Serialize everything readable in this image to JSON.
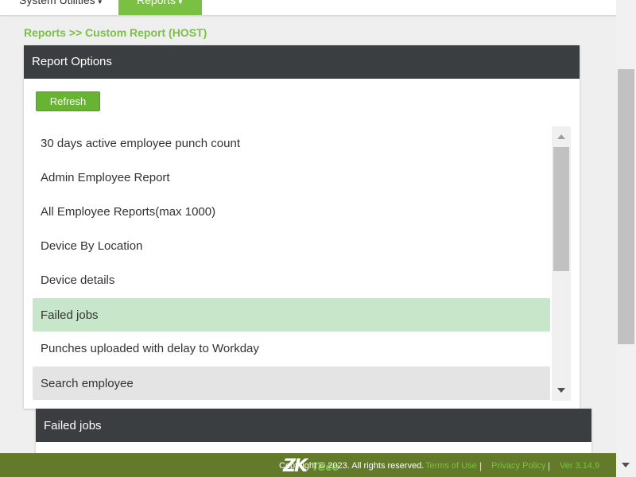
{
  "nav": {
    "items": [
      {
        "label": "System Utilities",
        "active": false
      },
      {
        "label": "Reports",
        "active": true
      }
    ]
  },
  "breadcrumb": "Reports >> Custom Report (HOST)",
  "report_options": {
    "title": "Report Options",
    "refresh_label": "Refresh",
    "list": [
      {
        "label": "30 days active employee punch count"
      },
      {
        "label": "Admin Employee Report"
      },
      {
        "label": "All Employee Reports(max 1000)"
      },
      {
        "label": "Device By Location"
      },
      {
        "label": "Device details"
      },
      {
        "label": "Failed jobs",
        "selected": true
      },
      {
        "label": "Punches uploaded with delay to Workday"
      },
      {
        "label": "Search employee",
        "hovered": true
      }
    ]
  },
  "result_panel": {
    "title": "Failed jobs"
  },
  "footer": {
    "logo": {
      "part1": "ZK",
      "part2": "Teco"
    },
    "copyright": "Copyright © 2023. All rights reserved.",
    "links": {
      "terms": "Terms of Use",
      "privacy": "Privacy Policy",
      "version": "Ver 3.14.9"
    },
    "separator": "|"
  },
  "colors": {
    "brand_green": "#7ac143",
    "header_dark": "#3b3e40",
    "footer_olive": "#627a29",
    "selected_row": "#c8e6ca"
  }
}
